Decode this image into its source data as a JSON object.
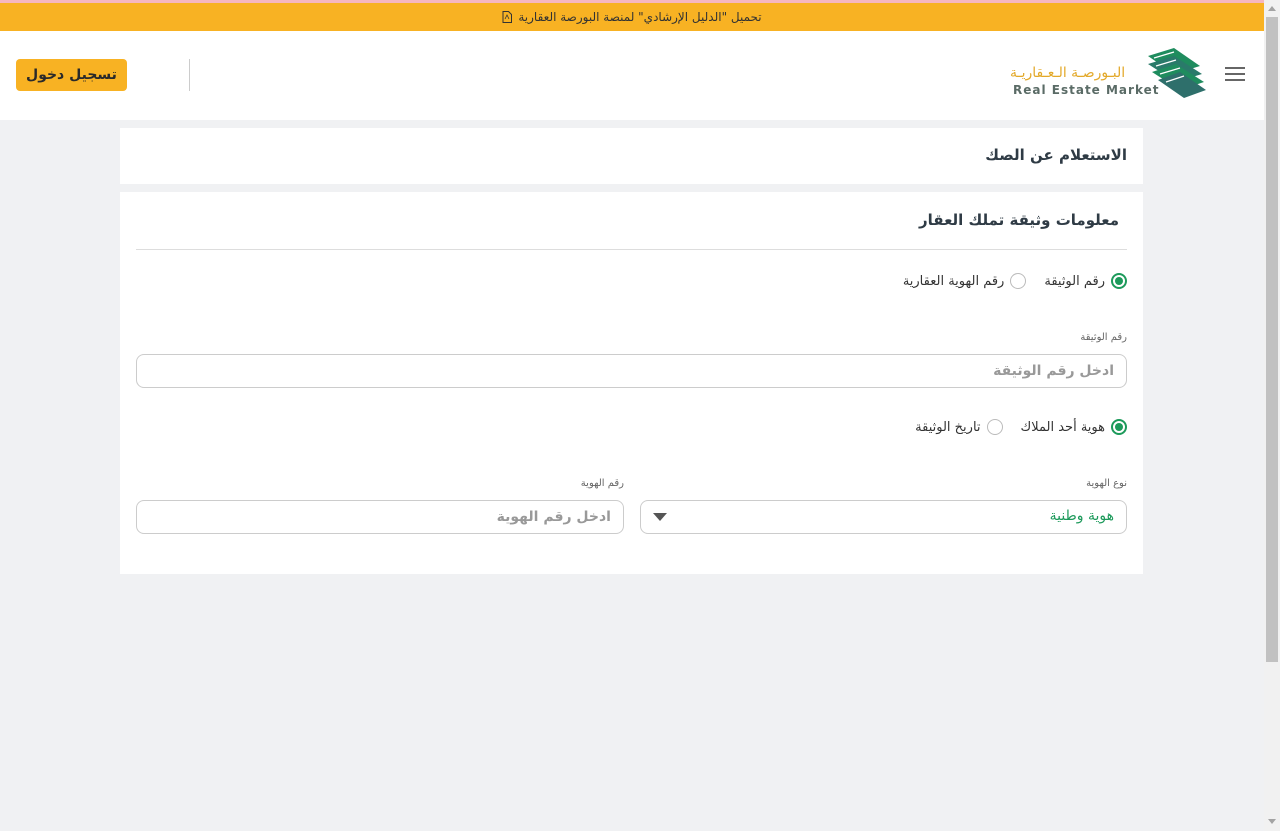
{
  "banner": {
    "text": "تحميل \"الدليل الإرشادي\" لمنصة البورصة العقارية",
    "icon": "pdf-file-icon"
  },
  "header": {
    "logo_ar": "البـورصـة الـعـقاريـة",
    "logo_en": "Real Estate Market",
    "login_label": "تسجيل دخول",
    "menu_icon": "hamburger-menu-icon"
  },
  "page": {
    "title": "الاستعلام عن الصك"
  },
  "form": {
    "section_title": "معلومات وثيقة تملك العقار",
    "doc_type_options": [
      "رقم الوثيقة",
      "رقم الهوية العقارية"
    ],
    "doc_type_selected": "رقم الوثيقة",
    "doc_number_label": "رقم الوثيقة",
    "doc_number_placeholder": "ادخل رقم الوثيقة",
    "owner_options": [
      "هوية أحد الملاك",
      "تاريخ الوثيقة"
    ],
    "owner_selected": "هوية أحد الملاك",
    "id_type_label": "نوع الهوية",
    "id_type_value": "هوية وطنية",
    "id_number_label": "رقم الهوية",
    "id_number_placeholder": "ادخل رقم الهوية"
  },
  "colors": {
    "accent": "#f8b223",
    "primary_green": "#1d9a5b",
    "logo_gold": "#e3a92a"
  }
}
